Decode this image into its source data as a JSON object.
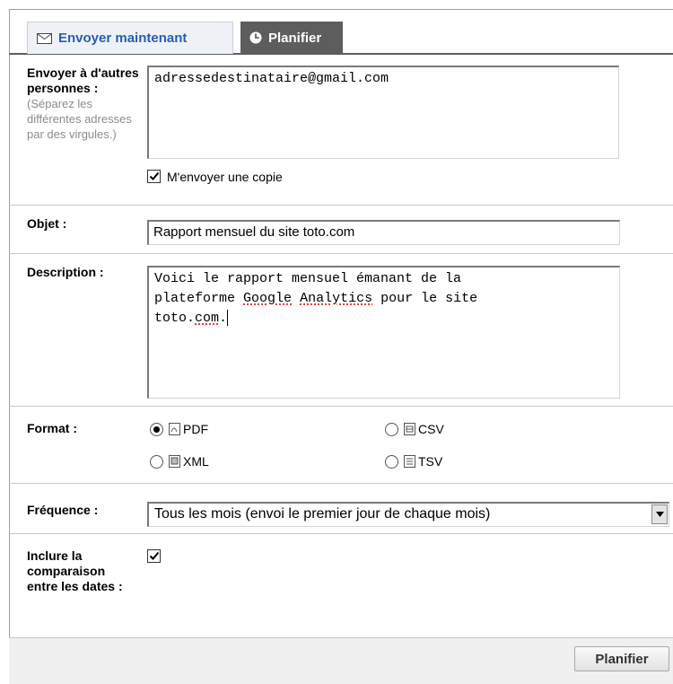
{
  "tabs": {
    "send_now": "Envoyer maintenant",
    "schedule": "Planifier"
  },
  "recipients": {
    "label": "Envoyer à d'autres personnes :",
    "hint": "(Séparez les différentes adresses par des virgules.)",
    "value": "adressedestinataire@gmail.com",
    "copy_label": "M'envoyer une copie",
    "copy_checked": true
  },
  "subject": {
    "label": "Objet :",
    "value": "Rapport mensuel du site toto.com"
  },
  "description": {
    "label": "Description :",
    "line1": "Voici le rapport mensuel émanant de la",
    "line2_a": "plateforme ",
    "line2_google": "Google",
    "line2_space": " ",
    "line2_analytics": "Analytics",
    "line2_b": " pour le site",
    "line3_a": "toto.",
    "line3_com": "com",
    "line3_b": "."
  },
  "format": {
    "label": "Format :",
    "options": [
      {
        "label": "PDF",
        "selected": true,
        "icon": "pdf-file-icon"
      },
      {
        "label": "CSV",
        "selected": false,
        "icon": "csv-file-icon"
      },
      {
        "label": "XML",
        "selected": false,
        "icon": "xml-file-icon"
      },
      {
        "label": "TSV",
        "selected": false,
        "icon": "tsv-file-icon"
      }
    ]
  },
  "frequency": {
    "label": "Fréquence :",
    "value": "Tous les mois (envoi le premier jour de chaque mois)"
  },
  "compare": {
    "label": "Inclure la comparaison entre les dates :",
    "checked": true
  },
  "footer": {
    "submit_label": "Planifier"
  },
  "colors": {
    "tab_active_bg": "#5d5d5d",
    "tab_inactive_text": "#2a5db0",
    "footer_bg": "#f0f0f0"
  }
}
